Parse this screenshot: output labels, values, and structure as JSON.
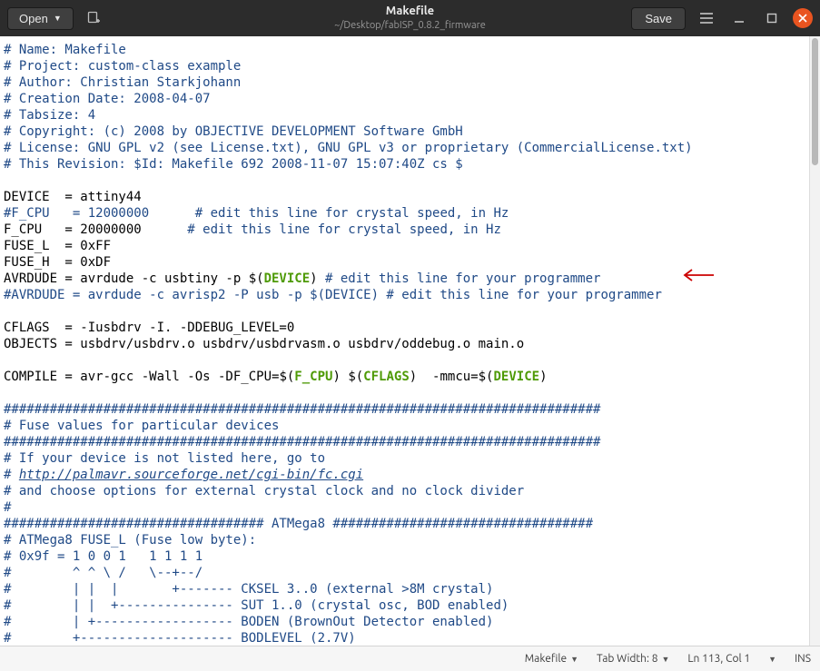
{
  "titlebar": {
    "open_label": "Open",
    "title": "Makefile",
    "subtitle": "~/Desktop/fabISP_0.8.2_firmware",
    "save_label": "Save"
  },
  "code": {
    "l1": "# Name: Makefile",
    "l2": "# Project: custom-class example",
    "l3": "# Author: Christian Starkjohann",
    "l4": "# Creation Date: 2008-04-07",
    "l5": "# Tabsize: 4",
    "l6": "# Copyright: (c) 2008 by OBJECTIVE DEVELOPMENT Software GmbH",
    "l7": "# License: GNU GPL v2 (see License.txt), GNU GPL v3 or proprietary (CommercialLicense.txt)",
    "l8": "# This Revision: $Id: Makefile 692 2008-11-07 15:07:40Z cs $",
    "l9": "",
    "l10a": "DEVICE  = attiny44",
    "l11a": "#F_CPU   = 12000000",
    "l11b": "      # edit this line for crystal speed, in Hz",
    "l12a": "F_CPU   = 20000000",
    "l12b": "      # edit this line for crystal speed, in Hz",
    "l13": "FUSE_L  = 0xFF",
    "l14": "FUSE_H  = 0xDF",
    "l15a": "AVRDUDE = avrdude -c usbtiny -p ",
    "l15b": "$(",
    "l15c": "DEVICE",
    "l15d": ") ",
    "l15e": "# edit this line for your programmer",
    "l16": "#AVRDUDE = avrdude -c avrisp2 -P usb -p $(DEVICE) # edit this line for your programmer",
    "l17": "",
    "l18": "CFLAGS  = -Iusbdrv -I. -DDEBUG_LEVEL=0",
    "l19": "OBJECTS = usbdrv/usbdrv.o usbdrv/usbdrvasm.o usbdrv/oddebug.o main.o",
    "l20": "",
    "l21a": "COMPILE = avr-gcc -Wall -Os -DF_CPU=",
    "l21b": "$(",
    "l21c": "F_CPU",
    "l21d": ") ",
    "l21e": "$(",
    "l21f": "CFLAGS",
    "l21g": ") ",
    "l21h": " -mmcu=",
    "l21i": "$(",
    "l21j": "DEVICE",
    "l21k": ")",
    "l22": "",
    "l23": "##############################################################################",
    "l24": "# Fuse values for particular devices",
    "l25": "##############################################################################",
    "l26": "# If your device is not listed here, go to",
    "l27a": "# ",
    "l27b": "http://palmavr.sourceforge.net/cgi-bin/fc.cgi",
    "l28": "# and choose options for external crystal clock and no clock divider",
    "l29": "#",
    "l30": "################################## ATMega8 ##################################",
    "l31": "# ATMega8 FUSE_L (Fuse low byte):",
    "l32": "# 0x9f = 1 0 0 1   1 1 1 1",
    "l33": "#        ^ ^ \\ /   \\--+--/",
    "l34": "#        | |  |       +------- CKSEL 3..0 (external >8M crystal)",
    "l35": "#        | |  +--------------- SUT 1..0 (crystal osc, BOD enabled)",
    "l36": "#        | +------------------ BODEN (BrownOut Detector enabled)",
    "l37": "#        +-------------------- BODLEVEL (2.7V)"
  },
  "statusbar": {
    "lang": "Makefile",
    "tab": "Tab Width: 8",
    "pos": "Ln 113, Col 1",
    "mode": "INS"
  }
}
